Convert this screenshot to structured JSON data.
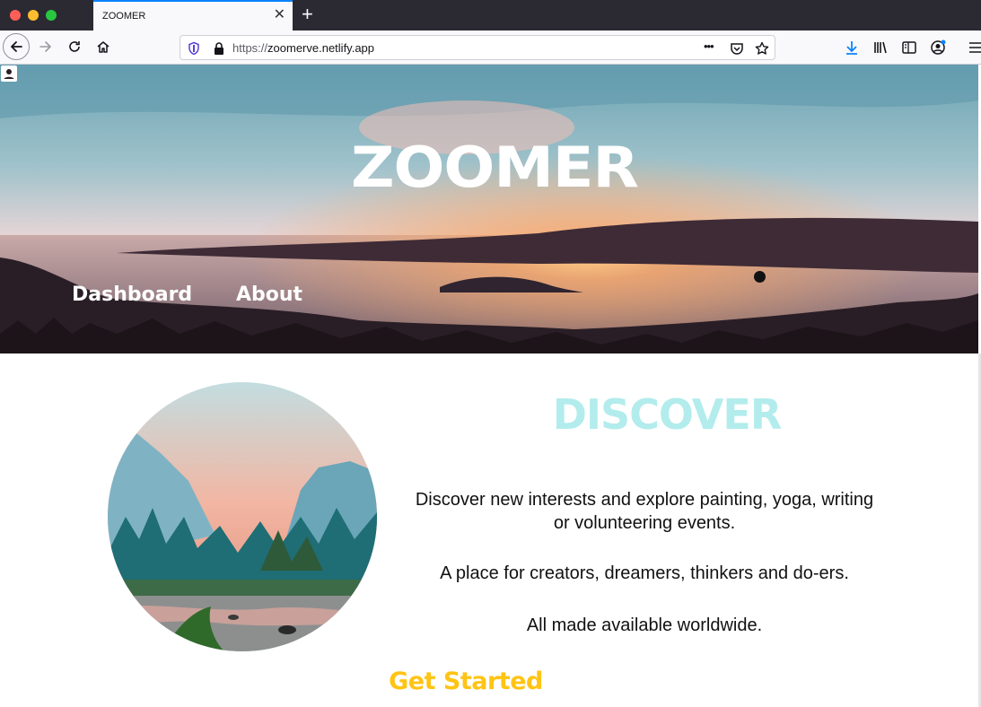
{
  "browser": {
    "tab_title": "ZOOMER",
    "tab_close": "✕",
    "new_tab": "+",
    "url_prefix": "https://",
    "url_domain": "zoomerve.netlify.app",
    "more": "•••",
    "icons": [
      "back-icon",
      "forward-icon",
      "reload-icon",
      "home-icon",
      "shield-icon",
      "lock-icon",
      "pocket-icon",
      "bookmark-star-icon",
      "download-icon",
      "library-icon",
      "sidebar-icon",
      "account-icon",
      "menu-icon"
    ]
  },
  "header": {
    "brand": "ZOOMER",
    "nav": [
      "Dashboard",
      "About"
    ]
  },
  "main": {
    "heading": "DISCOVER",
    "paragraphs": [
      "Discover new interests and explore painting, yoga, writing or volunteering events.",
      "A place for creators, dreamers, thinkers and do-ers.",
      "All made available worldwide."
    ],
    "cta": "Get Started"
  },
  "colors": {
    "discover": "#b3ecec",
    "cta": "#ffc414",
    "tab_accent": "#0a84ff"
  }
}
